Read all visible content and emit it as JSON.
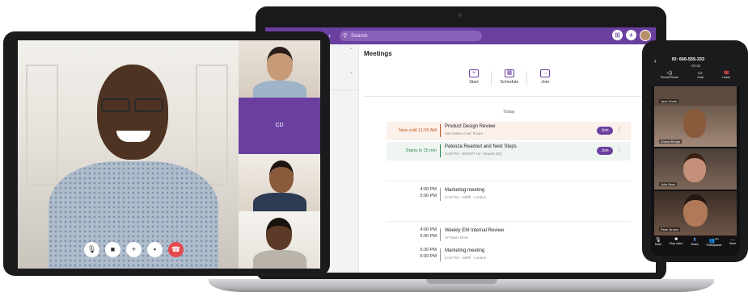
{
  "laptop": {
    "search_placeholder": "Search",
    "page_title": "Meetings",
    "actions": [
      {
        "label": "Start",
        "icon": "video-plus-icon"
      },
      {
        "label": "Schedule",
        "icon": "calendar-icon"
      },
      {
        "label": "Join",
        "icon": "join-icon"
      }
    ],
    "today_label": "Today",
    "join_label": "Join",
    "meetings": [
      {
        "time1": "Now until 11:00 AM",
        "time2": "",
        "name": "Product Design Review",
        "location": "San Mateo Conf. Room",
        "time_color": "#c4521f",
        "has_join": true
      },
      {
        "time1": "Starts in 15 min",
        "time2": "",
        "name": "Palooza Readout and Next Steps",
        "location": "Conf Rm - BMTEP 1st - Bryant (32)",
        "time_color": "#2c8a56",
        "has_join": true
      },
      {
        "time1": "4:00 PM",
        "time2": "5:00 PM",
        "name": "Marketing meeting",
        "location": "Conf Rm - SMfh - London",
        "time_color": "#333333",
        "has_join": false
      },
      {
        "time1": "4:00 PM",
        "time2": "5:00 PM",
        "name": "Weekly EM Internal Review",
        "location": "37 Davis Drive",
        "time_color": "#333333",
        "has_join": false
      },
      {
        "time1": "5:30 PM",
        "time2": "6:00 PM",
        "name": "Marketing meeting",
        "location": "Conf Rm - SMfh - London",
        "time_color": "#333333",
        "has_join": false
      }
    ]
  },
  "tablet": {
    "placeholder_initials": "CD",
    "controls": [
      "microphone-icon",
      "video-camera-icon",
      "add-icon",
      "chat-icon",
      "end-call-icon"
    ]
  },
  "phone": {
    "meeting_id": "ID: 666-555-333",
    "duration": "02:32",
    "top_tools": [
      {
        "label": "Phone/Phone",
        "icon": "speaker-icon"
      },
      {
        "label": "Chat",
        "icon": "chat-icon"
      },
      {
        "label": "Leave",
        "icon": "leave-icon"
      }
    ],
    "participants": [
      "Jane Smith",
      "Emma Bridge",
      "Julie Moor",
      "Peter Brown"
    ],
    "bottom_tools": [
      {
        "label": "Mute",
        "icon": "microphone-icon"
      },
      {
        "label": "Stop video",
        "icon": "video-camera-icon"
      },
      {
        "label": "Share",
        "icon": "share-icon"
      },
      {
        "label": "Participants",
        "icon": "participants-icon"
      },
      {
        "label": "More",
        "icon": "more-icon"
      }
    ],
    "participant_count": "20+"
  },
  "colors": {
    "brand_purple": "#6a3fa0",
    "end_call_red": "#e5484d"
  }
}
